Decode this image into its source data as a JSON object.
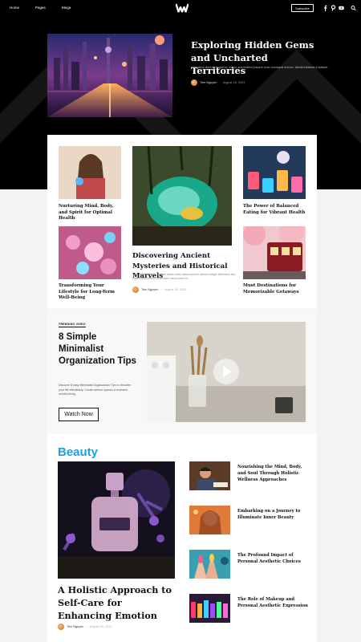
{
  "nav": {
    "links": [
      "Home",
      "Pages",
      "Mega"
    ],
    "subscribe_label": "Subscribe",
    "social_icons": [
      "facebook-icon",
      "pinterest-icon",
      "youtube-icon"
    ],
    "search_icon": "search-icon"
  },
  "hero": {
    "title": "Exploring Hidden Gems and Uncharted Territories",
    "excerpt": "Himenaeos diam est feugiat ex, mus ut urna eleifend posuere curae consequat at lorem, blandit habitasse a habitant...",
    "author": "Tien Nguyen",
    "date": "August 18, 2023"
  },
  "grid": {
    "top_left": "Nurturing Mind, Body, and Spirit for Optimal Health",
    "bottom_left": "Transforming Your Lifestyle for Long-Term Well-Being",
    "top_right": "The Power of Balanced Eating for Vibrant Health",
    "bottom_right": "Must Destinations for Memorizable Getaways",
    "main_title": "Discovering Ancient Mysteries and Historical Marvels",
    "main_excerpt": "Odio potenti aliquet aliquam lectus tortor massa laoreet ultrices integer bibendum nec, malesuada pretium vestibulum metus tortor et...",
    "main_author": "Tien Nguyen",
    "main_date": "August 18, 2023"
  },
  "video": {
    "label": "TRENDING VIDEO",
    "title": "8 Simple Minimalist Organization Tips",
    "excerpt": "Discover 8 easy Minimalist Organization Tips to declutter your life effortlessly. Create serene spaces & embrace mindful living.",
    "button": "Watch Now"
  },
  "beauty": {
    "heading": "Beauty",
    "feature_title": "A Holistic Approach to Self-Care for Enhancing Emotion",
    "feature_author": "Tien Nguyen",
    "feature_date": "August 18, 2023",
    "list": [
      "Nourishing the Mind, Body, and Soul Through Holistic Wellness Approaches",
      "Embarking on a Journey to Illuminate Inner Beauty",
      "The Profound Impact of Personal Aesthetic Choices",
      "The Role of Makeup and Personal Aesthetic Expression"
    ]
  },
  "colors": {
    "accent": "#1aa0e6",
    "nav_bg": "#000000",
    "page_bg": "#f3f3f3"
  }
}
